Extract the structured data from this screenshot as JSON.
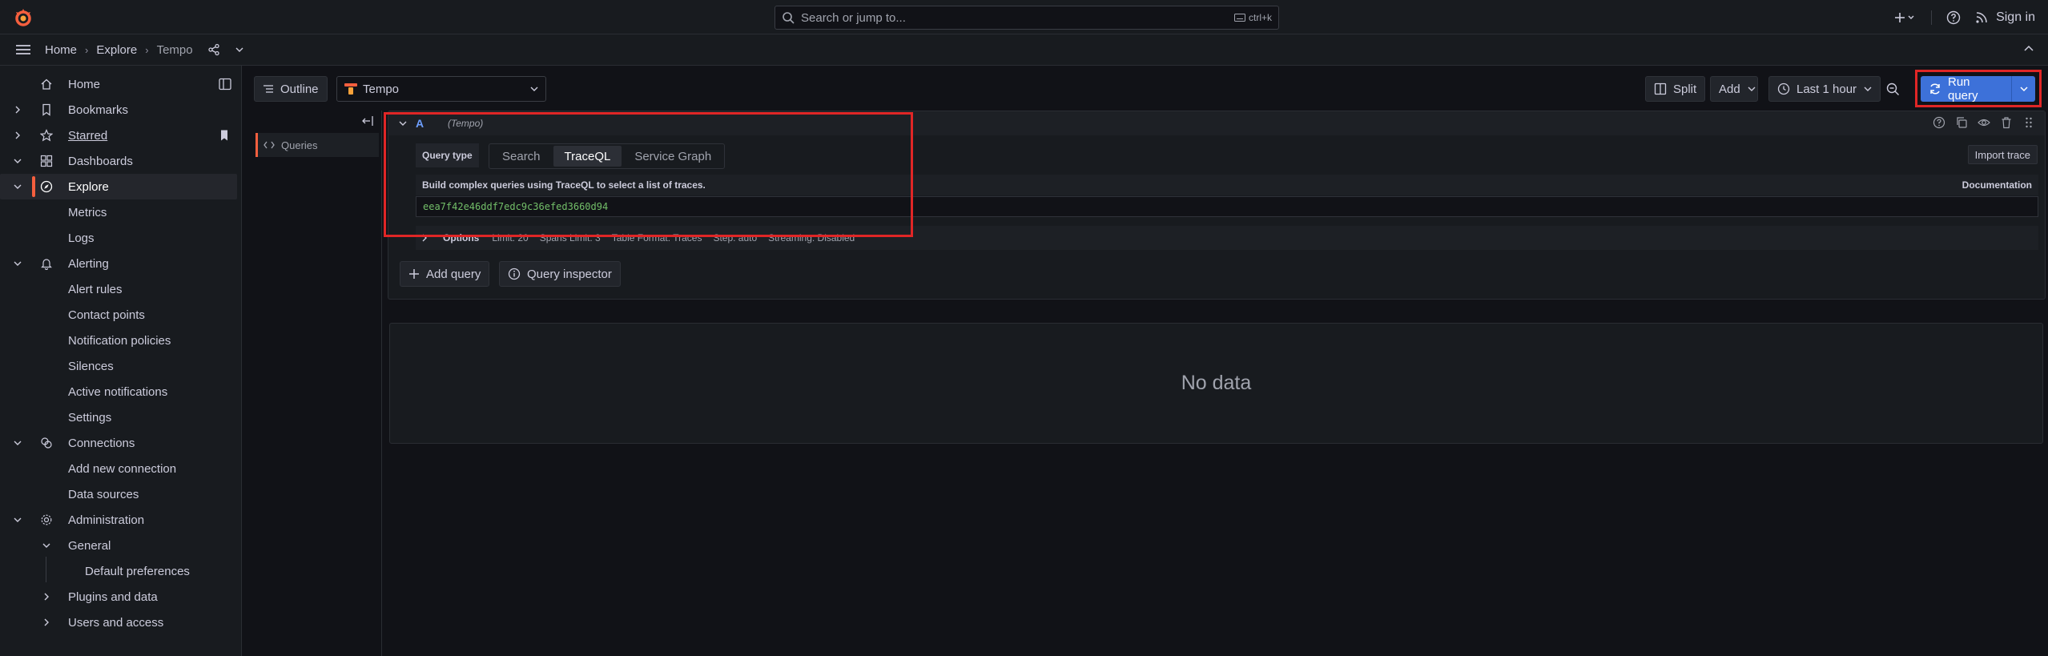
{
  "topbar": {
    "search_placeholder": "Search or jump to...",
    "shortcut": "ctrl+k",
    "sign_in": "Sign in",
    "accent_color": "#f55f3e"
  },
  "breadcrumb": {
    "items": [
      "Home",
      "Explore",
      "Tempo"
    ]
  },
  "sidebar": {
    "items": [
      {
        "label": "Home",
        "icon": "home-icon"
      },
      {
        "label": "Bookmarks",
        "icon": "bookmark-icon"
      },
      {
        "label": "Starred",
        "icon": "star-icon"
      },
      {
        "label": "Dashboards",
        "icon": "dashboards-icon"
      },
      {
        "label": "Explore",
        "icon": "compass-icon"
      },
      {
        "label": "Metrics"
      },
      {
        "label": "Logs"
      },
      {
        "label": "Alerting",
        "icon": "bell-icon"
      },
      {
        "label": "Alert rules"
      },
      {
        "label": "Contact points"
      },
      {
        "label": "Notification policies"
      },
      {
        "label": "Silences"
      },
      {
        "label": "Active notifications"
      },
      {
        "label": "Settings"
      },
      {
        "label": "Connections",
        "icon": "connections-icon"
      },
      {
        "label": "Add new connection"
      },
      {
        "label": "Data sources"
      },
      {
        "label": "Administration",
        "icon": "cog-icon"
      },
      {
        "label": "General"
      },
      {
        "label": "Default preferences"
      },
      {
        "label": "Plugins and data"
      },
      {
        "label": "Users and access"
      }
    ]
  },
  "toolbar": {
    "outline": "Outline",
    "datasource": "Tempo",
    "split": "Split",
    "add": "Add",
    "time_range": "Last 1 hour",
    "run_query": "Run query"
  },
  "outline_panel": {
    "queries": "Queries"
  },
  "query": {
    "ref_id": "A",
    "datasource": "(Tempo)",
    "query_type_label": "Query type",
    "tabs": [
      "Search",
      "TraceQL",
      "Service Graph"
    ],
    "selected_tab": "TraceQL",
    "import_trace": "Import trace",
    "help_text": "Build complex queries using TraceQL to select a list of traces.",
    "documentation": "Documentation",
    "traceql_value": "eea7f42e46ddf7edc9c36efed3660d94",
    "options_label": "Options",
    "options": [
      "Limit: 20",
      "Spans Limit: 3",
      "Table Format: Traces",
      "Step: auto",
      "Streaming: Disabled"
    ]
  },
  "actions": {
    "add_query": "Add query",
    "query_inspector": "Query inspector"
  },
  "results": {
    "no_data": "No data"
  }
}
